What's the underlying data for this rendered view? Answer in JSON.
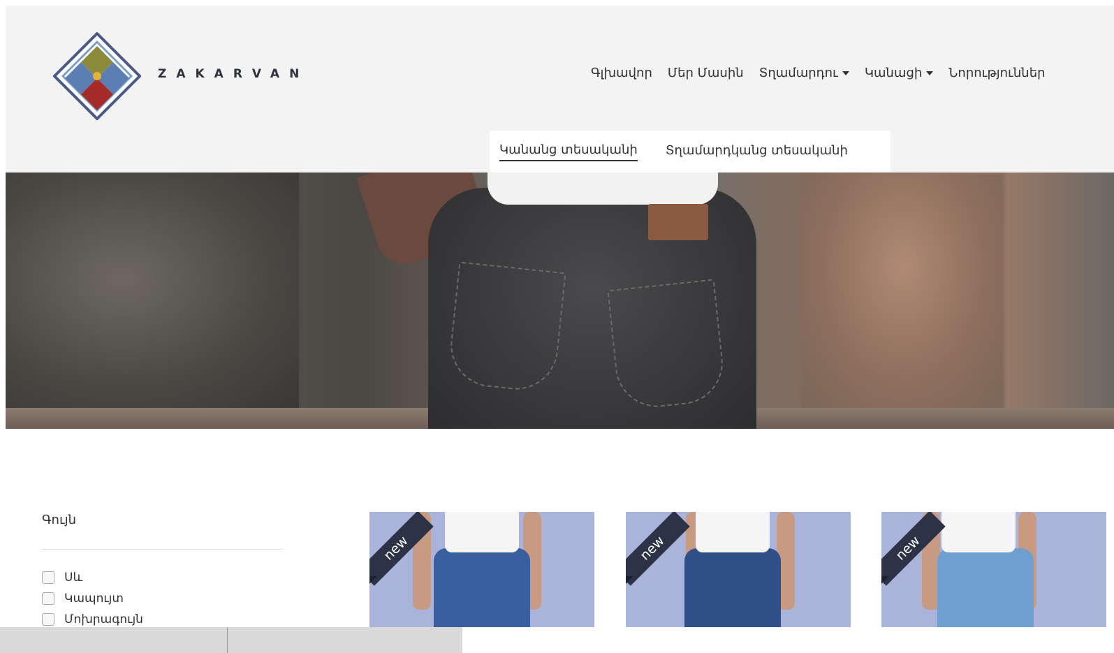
{
  "header": {
    "brand": "ZAKARVAN",
    "nav": [
      {
        "label": "Գլխավոր",
        "has_dropdown": false
      },
      {
        "label": "Մեր Մասին",
        "has_dropdown": false
      },
      {
        "label": "Տղամարդու",
        "has_dropdown": true
      },
      {
        "label": "Կանացի",
        "has_dropdown": true
      },
      {
        "label": "Նորություններ",
        "has_dropdown": false
      }
    ],
    "subtabs": [
      {
        "label": "Կանանց տեսականի",
        "active": true
      },
      {
        "label": "Տղամարդկանց տեսականի",
        "active": false
      }
    ]
  },
  "filter": {
    "title": "Գույն",
    "options": [
      {
        "label": "Սև",
        "checked": false
      },
      {
        "label": "Կապույտ",
        "checked": false
      },
      {
        "label": "Մոխրագույն",
        "checked": false
      }
    ]
  },
  "products": [
    {
      "ribbon": "new",
      "jeans_color": "#3a5f9e"
    },
    {
      "ribbon": "new",
      "jeans_color": "#2f4f88"
    },
    {
      "ribbon": "new",
      "jeans_color": "#6f9fd0"
    }
  ],
  "colors": {
    "header_bg": "#f3f3f3",
    "product_bg": "#aab3da",
    "ribbon": "#2c3346"
  }
}
